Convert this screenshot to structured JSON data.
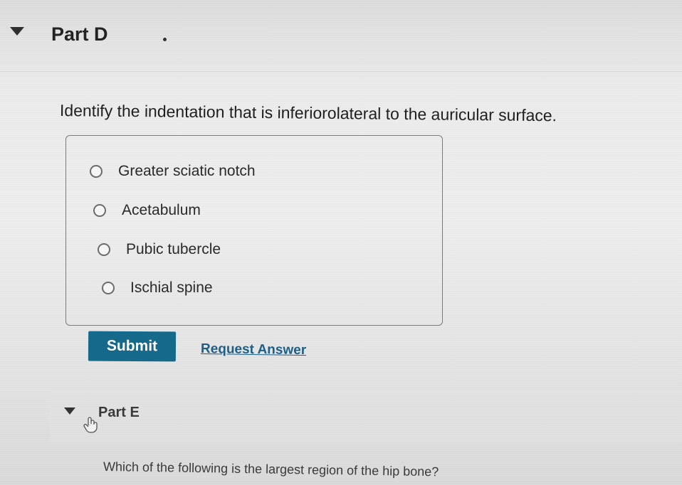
{
  "part_d": {
    "title": "Part D",
    "question": "Identify the indentation that is inferiorolateral to the auricular surface.",
    "options": [
      {
        "label": "Greater sciatic notch",
        "selected": false
      },
      {
        "label": "Acetabulum",
        "selected": false
      },
      {
        "label": "Pubic tubercle",
        "selected": false
      },
      {
        "label": "Ischial spine",
        "selected": false
      }
    ],
    "submit_label": "Submit",
    "request_answer_label": "Request Answer"
  },
  "part_e": {
    "title": "Part E",
    "question": "Which of the following is the largest region of the hip bone?"
  },
  "colors": {
    "submit_bg": "#156a8c",
    "link": "#1d5f86"
  },
  "icons": {
    "collapse": "caret-down-icon",
    "cursor": "hand-pointer-icon",
    "radio": "radio-unchecked-icon"
  }
}
